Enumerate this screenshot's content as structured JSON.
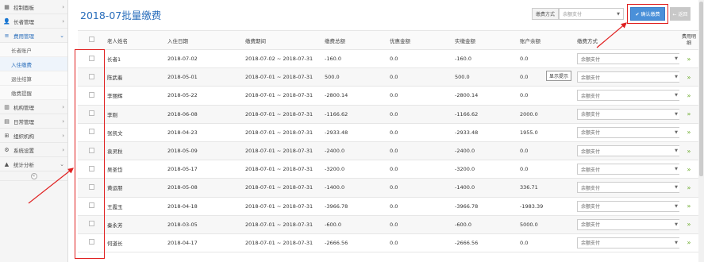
{
  "sidebar": {
    "items": [
      {
        "label": "控制面板",
        "icon": "dashboard-icon",
        "glyph": "▦",
        "chev": "›"
      },
      {
        "label": "长者管理",
        "icon": "users-icon",
        "glyph": "👤",
        "chev": "›"
      },
      {
        "label": "费用管理",
        "icon": "list-icon",
        "glyph": "≡",
        "chev": "⌄",
        "active": true
      }
    ],
    "sub_items": [
      {
        "label": "长者账户"
      },
      {
        "label": "入住缴费",
        "current": true
      },
      {
        "label": "退住结算"
      },
      {
        "label": "缴费提醒"
      }
    ],
    "items2": [
      {
        "label": "机构管理",
        "icon": "building-icon",
        "glyph": "▥",
        "chev": "›"
      },
      {
        "label": "日常管理",
        "icon": "calendar-icon",
        "glyph": "▤",
        "chev": "›"
      },
      {
        "label": "组织机构",
        "icon": "org-icon",
        "glyph": "⊞",
        "chev": "›"
      },
      {
        "label": "系统设置",
        "icon": "gear-icon",
        "glyph": "⚙",
        "chev": "›"
      },
      {
        "label": "统计分析",
        "icon": "chart-icon",
        "glyph": "▲",
        "chev": "⌄"
      }
    ],
    "collapse_glyph": "«"
  },
  "header": {
    "title": "2018-07批量缴费",
    "pay_method_label": "缴费方式",
    "pay_method_value": "余额支付",
    "confirm_label": "✔ 确认缴费",
    "back_label": "← 返回"
  },
  "tooltip": "显示提示",
  "table": {
    "headers": [
      "",
      "老人姓名",
      "入住日期",
      "缴费期间",
      "缴费总额",
      "优惠金额",
      "实缴金额",
      "账户余额",
      "缴费方式",
      "费用明细"
    ],
    "rows": [
      {
        "name": "长者1",
        "date": "2018-07-02",
        "period": "2018-07-02 ~ 2018-07-31",
        "total": "-160.0",
        "discount": "0.0",
        "actual": "-160.0",
        "balance": "0.0",
        "method": "余额支付"
      },
      {
        "name": "陈武着",
        "date": "2018-05-01",
        "period": "2018-07-01 ~ 2018-07-31",
        "total": "500.0",
        "discount": "0.0",
        "actual": "500.0",
        "balance": "0.0",
        "method": "余额支付"
      },
      {
        "name": "李丽辉",
        "date": "2018-05-22",
        "period": "2018-07-01 ~ 2018-07-31",
        "total": "-2800.14",
        "discount": "0.0",
        "actual": "-2800.14",
        "balance": "0.0",
        "method": "余额支付"
      },
      {
        "name": "李刚",
        "date": "2018-06-08",
        "period": "2018-07-01 ~ 2018-07-31",
        "total": "-1166.62",
        "discount": "0.0",
        "actual": "-1166.62",
        "balance": "2000.0",
        "method": "余额支付"
      },
      {
        "name": "张凯文",
        "date": "2018-04-23",
        "period": "2018-07-01 ~ 2018-07-31",
        "total": "-2933.48",
        "discount": "0.0",
        "actual": "-2933.48",
        "balance": "1955.0",
        "method": "余额支付"
      },
      {
        "name": "袁灵秋",
        "date": "2018-05-09",
        "period": "2018-07-01 ~ 2018-07-31",
        "total": "-2400.0",
        "discount": "0.0",
        "actual": "-2400.0",
        "balance": "0.0",
        "method": "余额支付"
      },
      {
        "name": "吴圣岱",
        "date": "2018-05-17",
        "period": "2018-07-01 ~ 2018-07-31",
        "total": "-3200.0",
        "discount": "0.0",
        "actual": "-3200.0",
        "balance": "0.0",
        "method": "余额支付"
      },
      {
        "name": "黄运朋",
        "date": "2018-05-08",
        "period": "2018-07-01 ~ 2018-07-31",
        "total": "-1400.0",
        "discount": "0.0",
        "actual": "-1400.0",
        "balance": "336.71",
        "method": "余额支付"
      },
      {
        "name": "王霞玉",
        "date": "2018-04-18",
        "period": "2018-07-01 ~ 2018-07-31",
        "total": "-3966.78",
        "discount": "0.0",
        "actual": "-3966.78",
        "balance": "-1983.39",
        "method": "余额支付"
      },
      {
        "name": "秦永芳",
        "date": "2018-03-05",
        "period": "2018-07-01 ~ 2018-07-31",
        "total": "-600.0",
        "discount": "0.0",
        "actual": "-600.0",
        "balance": "5000.0",
        "method": "余额支付"
      },
      {
        "name": "何道长",
        "date": "2018-04-17",
        "period": "2018-07-01 ~ 2018-07-31",
        "total": "-2666.56",
        "discount": "0.0",
        "actual": "-2666.56",
        "balance": "0.0",
        "method": "余额支付"
      }
    ],
    "expand_glyph": "»",
    "caret_glyph": "▼"
  },
  "colors": {
    "accent": "#2a6ebb",
    "highlight": "#e02020",
    "expand": "#6aaa2a"
  }
}
